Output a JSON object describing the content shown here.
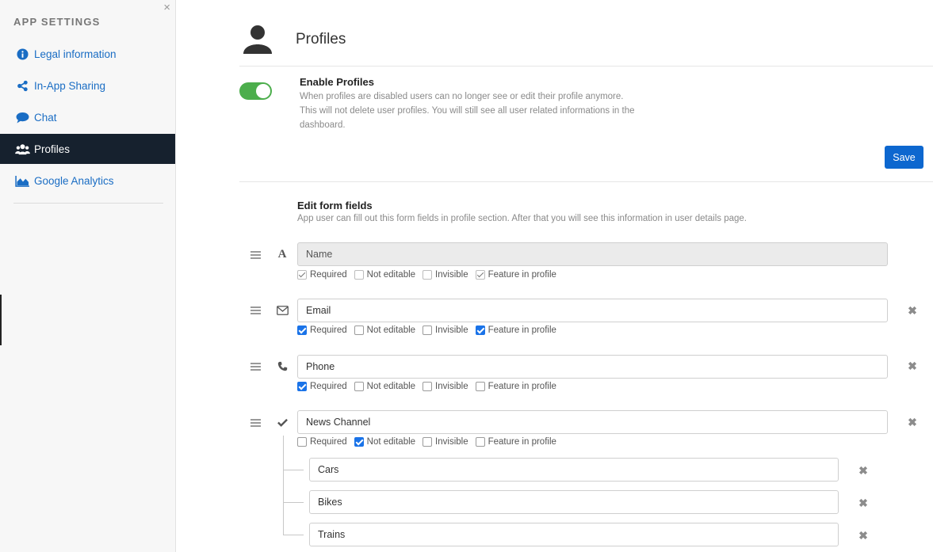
{
  "sidebar": {
    "heading": "APP SETTINGS",
    "close_glyph": "×",
    "items": [
      {
        "label": "Legal information",
        "icon": "info-icon"
      },
      {
        "label": "In-App Sharing",
        "icon": "share-icon"
      },
      {
        "label": "Chat",
        "icon": "chat-bubble-icon"
      },
      {
        "label": "Profiles",
        "icon": "users-icon",
        "active": true
      },
      {
        "label": "Google Analytics",
        "icon": "area-chart-icon"
      }
    ]
  },
  "header": {
    "title": "Profiles",
    "icon": "user-icon"
  },
  "enable": {
    "title": "Enable Profiles",
    "enabled": true,
    "description": "When profiles are disabled users can no longer see or edit their profile anymore. This will not delete user profiles. You will still see all user related informations in the dashboard."
  },
  "save_label": "Save",
  "form": {
    "title": "Edit form fields",
    "description": "App user can fill out this form fields in profile section. After that you will see this information in user details page.",
    "option_labels": {
      "required": "Required",
      "not_editable": "Not editable",
      "invisible": "Invisible",
      "feature": "Feature in profile"
    },
    "fields": [
      {
        "value": "Name",
        "type_icon": "text-type-icon",
        "locked": true,
        "required": true,
        "not_editable": false,
        "invisible": false,
        "feature": true
      },
      {
        "value": "Email",
        "type_icon": "envelope-icon",
        "locked": false,
        "required": true,
        "not_editable": false,
        "invisible": false,
        "feature": true
      },
      {
        "value": "Phone",
        "type_icon": "phone-icon",
        "locked": false,
        "required": true,
        "not_editable": false,
        "invisible": false,
        "feature": false
      },
      {
        "value": "News Channel",
        "type_icon": "checkmark-icon",
        "locked": false,
        "required": false,
        "not_editable": true,
        "invisible": false,
        "feature": false
      }
    ],
    "subfields": [
      {
        "value": "Cars"
      },
      {
        "value": "Bikes"
      },
      {
        "value": "Trains"
      }
    ],
    "remove_glyph": "✖"
  },
  "colors": {
    "accent": "#0d67cf",
    "toggle_on": "#4cae4c",
    "sidebar_active": "#16212e",
    "link": "#1a6dc4"
  }
}
